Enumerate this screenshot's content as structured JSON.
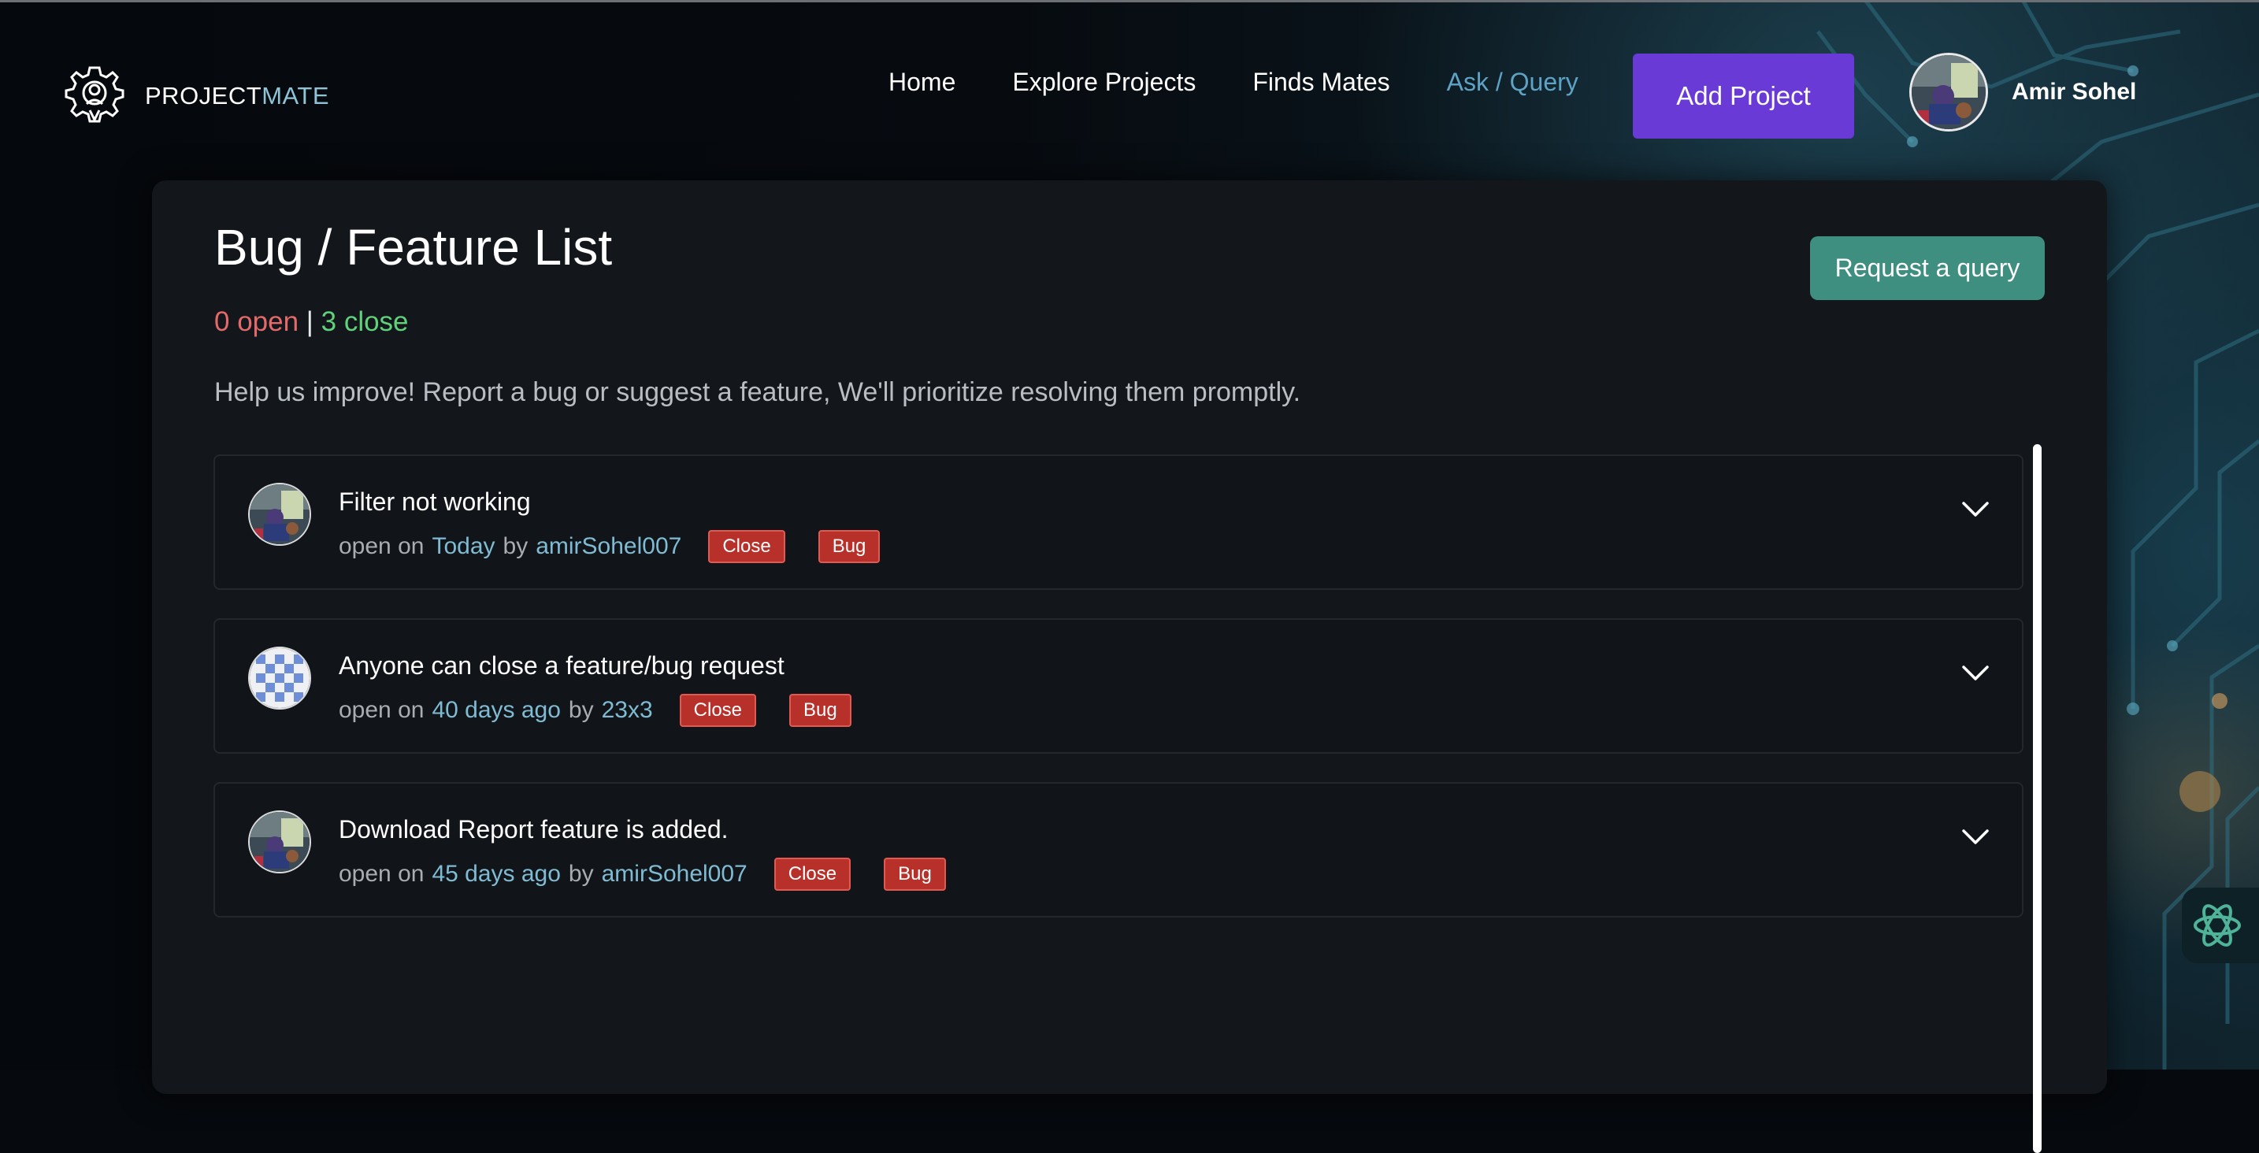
{
  "brand": {
    "name_part1": "PROJECT",
    "name_part2": "MATE"
  },
  "nav": {
    "items": [
      {
        "label": "Home"
      },
      {
        "label": "Explore Projects"
      },
      {
        "label": "Finds Mates"
      },
      {
        "label": "Ask / Query",
        "active": true
      }
    ],
    "add_project_label": "Add Project"
  },
  "user": {
    "name": "Amir Sohel"
  },
  "page": {
    "title": "Bug / Feature List",
    "open_count_text": "0 open",
    "separator": "|",
    "close_count_text": "3 close",
    "description": "Help us improve! Report a bug or suggest a feature, We'll prioritize resolving them promptly.",
    "request_button_label": "Request a query"
  },
  "issues": [
    {
      "title": "Filter not working",
      "status_prefix": "open on",
      "when": "Today",
      "by_label": "by",
      "author": "amirSohel007",
      "status_badge": "Close",
      "type_badge": "Bug",
      "avatar": "photo"
    },
    {
      "title": "Anyone can close a feature/bug request",
      "status_prefix": "open on",
      "when": "40 days ago",
      "by_label": "by",
      "author": "23x3",
      "status_badge": "Close",
      "type_badge": "Bug",
      "avatar": "identicon"
    },
    {
      "title": "Download Report feature is added.",
      "status_prefix": "open on",
      "when": "45 days ago",
      "by_label": "by",
      "author": "amirSohel007",
      "status_badge": "Close",
      "type_badge": "Bug",
      "avatar": "photo"
    }
  ],
  "colors": {
    "accent_purple": "#6a3ad6",
    "accent_teal": "#3f8f80",
    "open_red": "#e46a6a",
    "close_green": "#5fd27a",
    "badge_red": "#b8302a",
    "link_blue": "#7fbcd4"
  },
  "icons": [
    "gear-logo-icon",
    "chevron-down-icon",
    "chatbot-icon"
  ]
}
